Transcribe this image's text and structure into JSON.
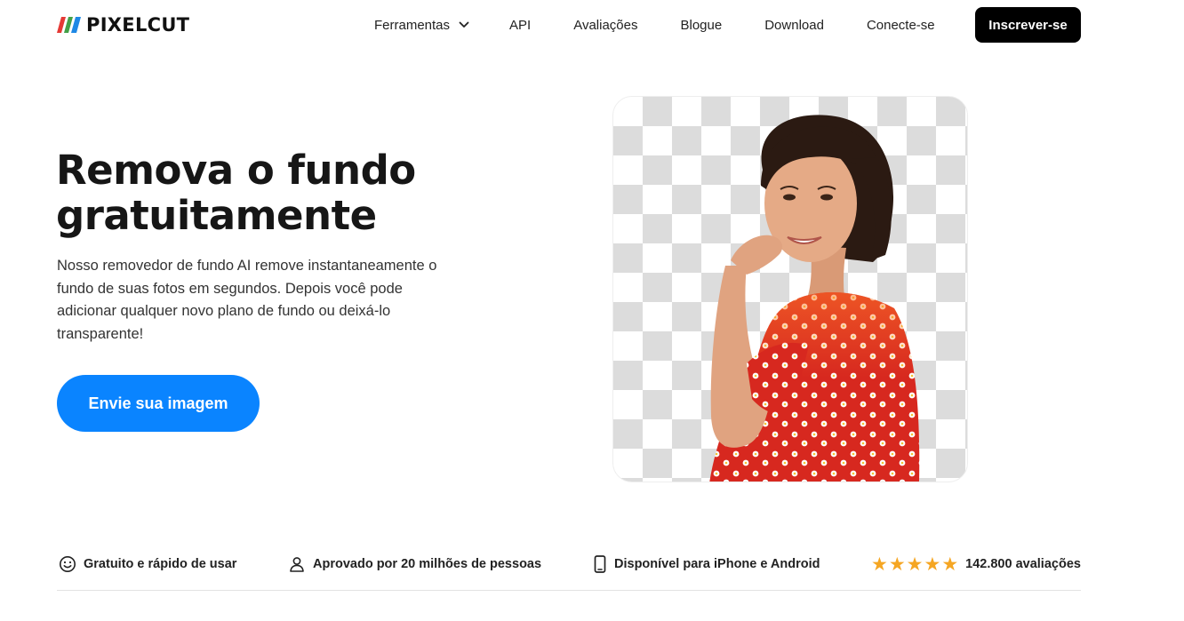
{
  "brand": {
    "name": "PIXELCUT",
    "logo_icon": "pixelcut-stripes-logo",
    "logo_colors": [
      "#e53935",
      "#43a047",
      "#1e88e5"
    ]
  },
  "nav": {
    "links": [
      {
        "label": "Ferramentas",
        "icon": "chevron-down-icon"
      },
      {
        "label": "API"
      },
      {
        "label": "Avaliações"
      },
      {
        "label": "Blogue"
      },
      {
        "label": "Download"
      },
      {
        "label": "Conecte-se"
      }
    ],
    "signup_label": "Inscrever-se"
  },
  "hero": {
    "title": "Remova o fundo gratuitamente",
    "description": "Nosso removedor de fundo AI remove instantaneamente o fundo de suas fotos em segundos. Depois você pode adicionar qualquer novo plano de fundo ou deixá-lo transparente!",
    "cta_label": "Envie sua imagem",
    "image_subject": "woman-smiling-transparent-background"
  },
  "features": [
    {
      "icon": "smile-icon",
      "label": "Gratuito e rápido de usar"
    },
    {
      "icon": "user-icon",
      "label": "Aprovado por 20 milhões de pessoas"
    },
    {
      "icon": "phone-icon",
      "label": "Disponível para iPhone e Android"
    },
    {
      "icon": "star-icon",
      "rating_stars": 5,
      "label": "142.800 avaliações"
    }
  ],
  "colors": {
    "accent": "#0a84ff",
    "signup_bg": "#000000",
    "star": "#f5a623"
  }
}
